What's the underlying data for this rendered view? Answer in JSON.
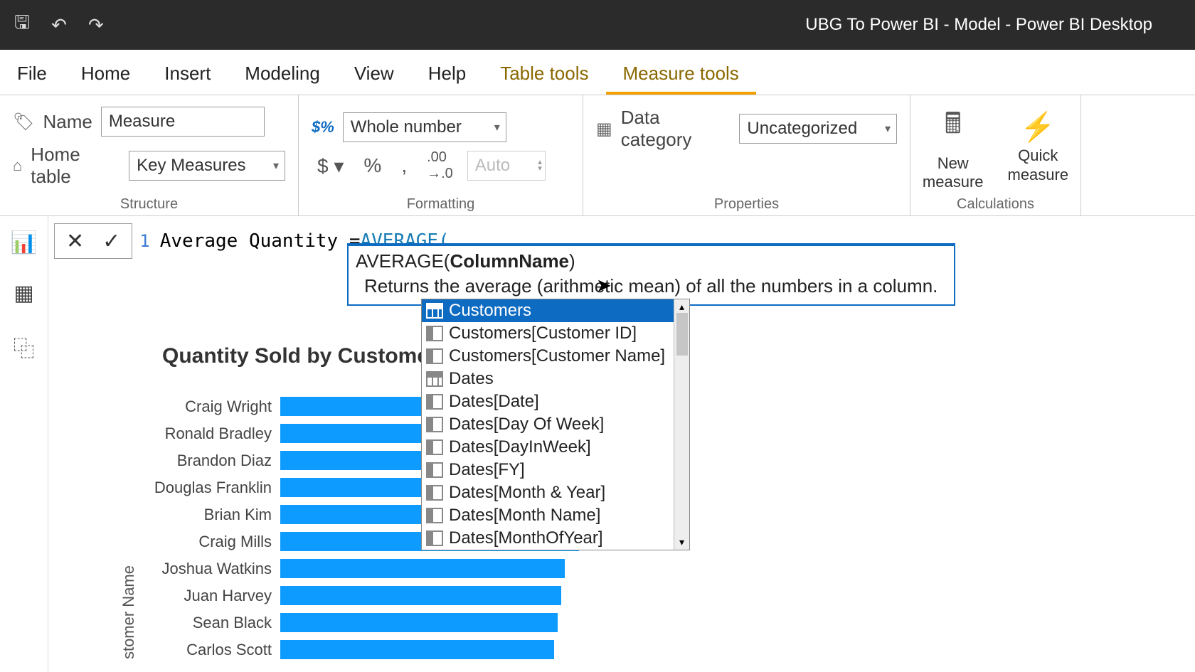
{
  "app_title": "UBG To Power BI - Model - Power BI Desktop",
  "menu": {
    "file": "File",
    "home": "Home",
    "insert": "Insert",
    "modeling": "Modeling",
    "view": "View",
    "help": "Help",
    "table_tools": "Table tools",
    "measure_tools": "Measure tools"
  },
  "ribbon": {
    "structure": {
      "label": "Structure",
      "name_lbl": "Name",
      "name_val": "Measure",
      "home_table_lbl": "Home table",
      "home_table_val": "Key Measures"
    },
    "formatting": {
      "label": "Formatting",
      "format_val": "Whole number",
      "auto": "Auto"
    },
    "properties": {
      "label": "Properties",
      "category_lbl": "Data category",
      "category_val": "Uncategorized"
    },
    "calculations": {
      "label": "Calculations",
      "new_measure": "New\nmeasure",
      "quick_measure": "Quick\nmeasure"
    }
  },
  "formula": {
    "line_no": "1",
    "text_prefix": "Average Quantity = ",
    "func_text": "AVERAGE(",
    "tooltip_sig_func": "AVERAGE(",
    "tooltip_sig_bold": "ColumnName",
    "tooltip_sig_close": ")",
    "tooltip_desc": "Returns the average (arithmetic mean) of all the numbers in a column."
  },
  "dropdown_items": [
    {
      "label": "Customers",
      "icon": "table",
      "selected": true
    },
    {
      "label": "Customers[Customer ID]",
      "icon": "col",
      "selected": false
    },
    {
      "label": "Customers[Customer Name]",
      "icon": "col",
      "selected": false
    },
    {
      "label": "Dates",
      "icon": "table",
      "selected": false
    },
    {
      "label": "Dates[Date]",
      "icon": "col",
      "selected": false
    },
    {
      "label": "Dates[Day Of Week]",
      "icon": "col",
      "selected": false
    },
    {
      "label": "Dates[DayInWeek]",
      "icon": "col",
      "selected": false
    },
    {
      "label": "Dates[FY]",
      "icon": "col",
      "selected": false
    },
    {
      "label": "Dates[Month & Year]",
      "icon": "col",
      "selected": false
    },
    {
      "label": "Dates[Month Name]",
      "icon": "col",
      "selected": false
    },
    {
      "label": "Dates[MonthOfYear]",
      "icon": "col",
      "selected": false
    }
  ],
  "chart_data": {
    "type": "bar",
    "title": "Quantity Sold by Customer Nam",
    "ylabel": "stomer Name",
    "categories": [
      "Craig Wright",
      "Ronald Bradley",
      "Brandon Diaz",
      "Douglas Franklin",
      "Brian Kim",
      "Craig Mills",
      "Joshua Watkins",
      "Juan Harvey",
      "Sean Black",
      "Carlos Scott"
    ],
    "values": [
      470,
      450,
      445,
      440,
      430,
      420,
      400,
      395,
      390,
      385
    ],
    "xlim": [
      0,
      500
    ]
  }
}
